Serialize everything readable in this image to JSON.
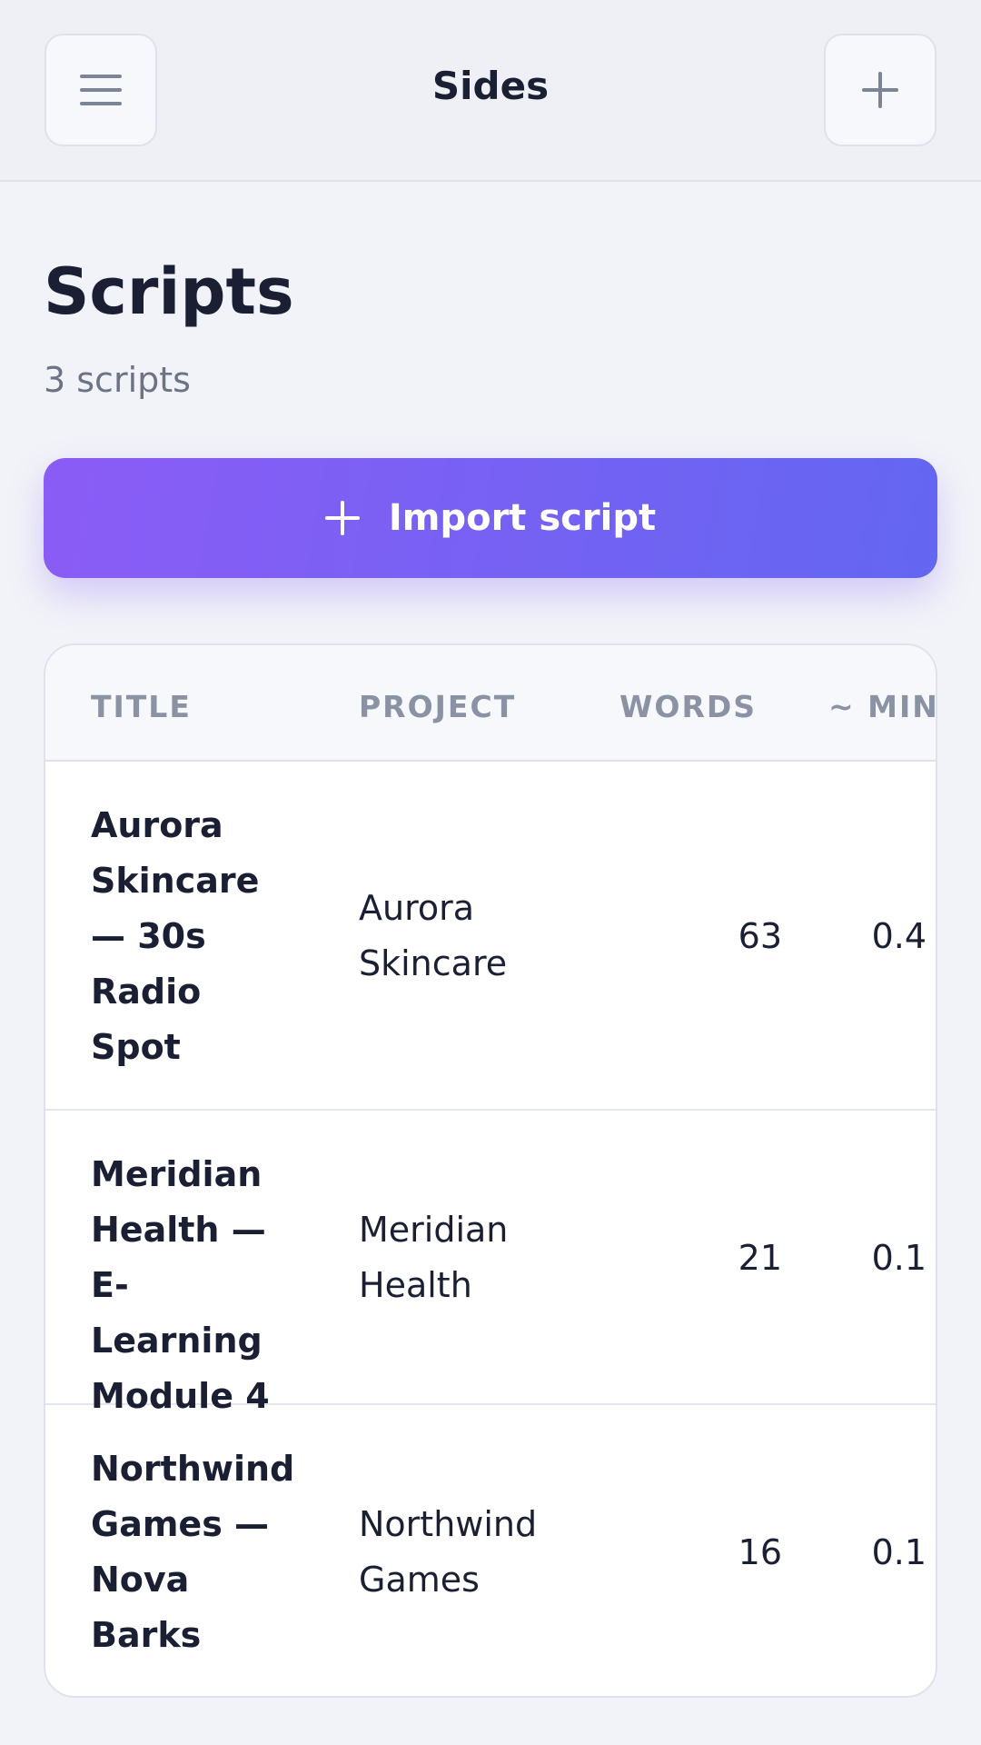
{
  "header": {
    "app_title": "Sides",
    "menu_icon": "hamburger-menu-icon",
    "add_icon": "plus-icon"
  },
  "page": {
    "title": "Scripts",
    "subtitle": "3 scripts"
  },
  "import_button": {
    "label": "Import script",
    "icon": "plus-icon",
    "gradient_start": "#8b5cf6",
    "gradient_end": "#6366f1"
  },
  "table": {
    "columns": [
      "TITLE",
      "PROJECT",
      "WORDS",
      "~ MIN"
    ],
    "rows": [
      {
        "title_lines": [
          "Aurora",
          "Skincare",
          "— 30s",
          "Radio",
          "Spot"
        ],
        "project_lines": [
          "Aurora",
          "Skincare"
        ],
        "words": "63",
        "min": "0.4"
      },
      {
        "title_lines": [
          "Meridian",
          "Health —",
          "E-Learning",
          "Module 4"
        ],
        "project_lines": [
          "Meridian",
          "Health"
        ],
        "words": "21",
        "min": "0.1"
      },
      {
        "title_lines": [
          "Northwind",
          "Games —",
          "Nova",
          "Barks"
        ],
        "project_lines": [
          "Northwind",
          "Games"
        ],
        "words": "16",
        "min": "0.1"
      }
    ]
  }
}
